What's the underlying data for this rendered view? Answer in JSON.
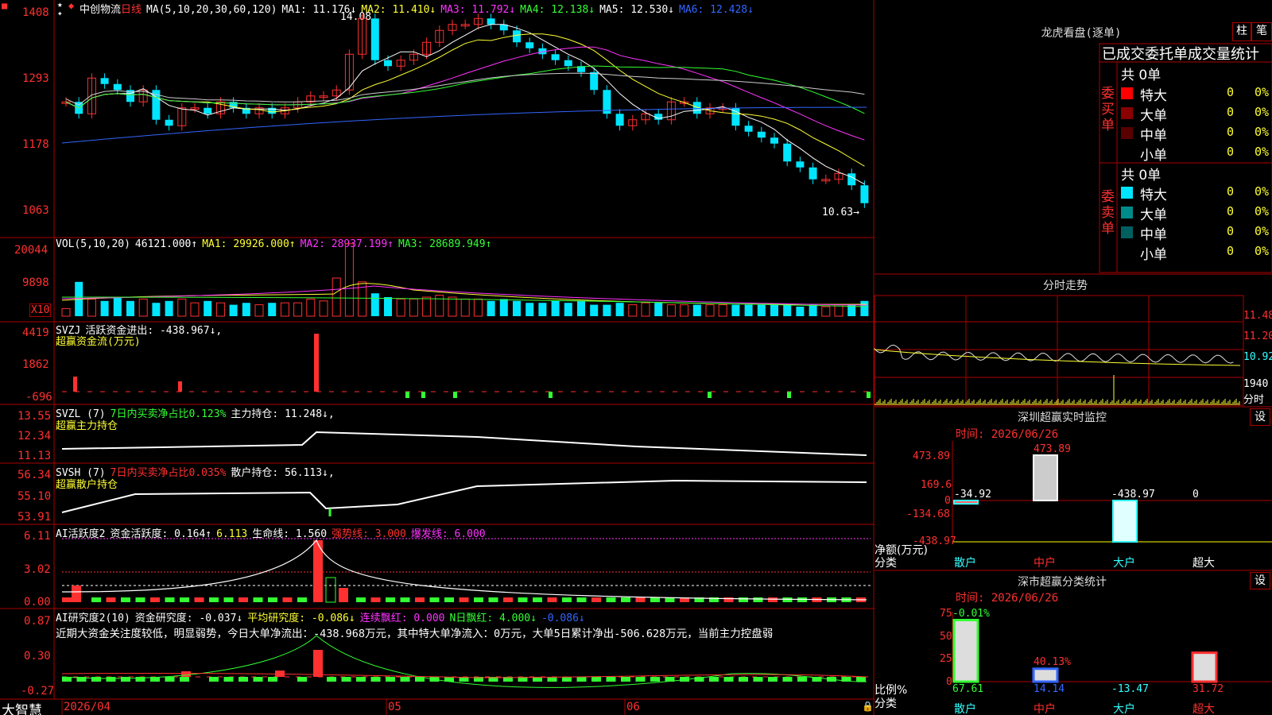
{
  "stock": {
    "name": "中创物流",
    "period": "日线",
    "ma_label": "MA(5,10,20,30,60,120)"
  },
  "price_panel": {
    "ma": [
      {
        "label": "MA1: 11.176↓",
        "color": "#ffffff"
      },
      {
        "label": "MA2: 11.410↓",
        "color": "#ffff33"
      },
      {
        "label": "MA3: 11.792↓",
        "color": "#ff33ff"
      },
      {
        "label": "MA4: 12.138↓",
        "color": "#33ff33"
      },
      {
        "label": "MA5: 12.530↓",
        "color": "#dddddd"
      },
      {
        "label": "MA6: 12.428↓",
        "color": "#3366ff"
      }
    ],
    "y_ticks": [
      "1408",
      "1293",
      "1178",
      "1063"
    ],
    "high_note": "14.08",
    "low_note": "10.63→"
  },
  "vol_panel": {
    "title": "VOL(5,10,20)",
    "value": "46121.000↑",
    "ma": [
      {
        "label": "MA1: 29926.000↑",
        "color": "#ffff33"
      },
      {
        "label": "MA2: 28937.199↑",
        "color": "#ff33ff"
      },
      {
        "label": "MA3: 28689.949↑",
        "color": "#33ff33"
      }
    ],
    "y_ticks": [
      "20044",
      "9898"
    ],
    "unit": "X10"
  },
  "svzj_panel": {
    "title": "SVZJ",
    "line1": "活跃资金进出: -438.967↓,",
    "line2": "超赢资金流(万元)",
    "y_ticks": [
      "4419",
      "1862",
      "-696"
    ]
  },
  "svzl_panel": {
    "title": "SVZL (7)",
    "ratio": "7日内买卖净占比0.123%",
    "hold": "主力持仓: 11.248↓,",
    "sub": "超赢主力持仓",
    "y_ticks": [
      "13.55",
      "12.34",
      "11.13"
    ]
  },
  "svsh_panel": {
    "title": "SVSH (7)",
    "ratio": "7日内买卖净占比0.035%",
    "hold": "散户持仓: 56.113↓,",
    "sub": "超赢散户持仓",
    "y_ticks": [
      "56.34",
      "55.10",
      "53.91"
    ]
  },
  "ai1_panel": {
    "title": "AI活跃度2",
    "a": "资金活跃度: 0.164↑",
    "b": "6.113",
    "c": "生命线: 1.560",
    "d": "强势线: 3.000",
    "e": "爆发线: 6.000",
    "y_ticks": [
      "6.11",
      "3.02",
      "0.00"
    ]
  },
  "ai2_panel": {
    "title": "AI研究度2(10)",
    "a": "资金研究度: -0.037↓",
    "b": "平均研究度: -0.086↓",
    "c": "连续飘红: 0.000",
    "d": "N日飘红: 4.000↓",
    "e": "-0.086↓",
    "comment": "近期大资金关注度较低，明显弱势，今日大单净流出：-438.968万元，其中特大单净流入：0万元，大单5日累计净出-506.628万元，当前主力控盘弱",
    "y_ticks": [
      "0.87",
      "0.30",
      "-0.27"
    ]
  },
  "x_axis": {
    "labels": [
      "2026/04",
      "05",
      "06"
    ],
    "app_name": "大智慧"
  },
  "lhb": {
    "title": "龙虎看盘(逐单)",
    "btn1": "柱",
    "btn2": "笔",
    "subtitle": "已成交委托单成交量统计",
    "buy": {
      "side": "委买单",
      "total": "共 0单",
      "rows": [
        {
          "label": "特大",
          "color": "#ff0000",
          "v": "0",
          "p": "0%"
        },
        {
          "label": "大单",
          "color": "#8b0000",
          "v": "0",
          "p": "0%"
        },
        {
          "label": "中单",
          "color": "#5a0000",
          "v": "0",
          "p": "0%"
        },
        {
          "label": "小单",
          "color": "#000000",
          "v": "0",
          "p": "0%"
        }
      ]
    },
    "sell": {
      "side": "委卖单",
      "total": "共 0单",
      "rows": [
        {
          "label": "特大",
          "color": "#00e5ff",
          "v": "0",
          "p": "0%"
        },
        {
          "label": "大单",
          "color": "#008b8b",
          "v": "0",
          "p": "0%"
        },
        {
          "label": "中单",
          "color": "#006060",
          "v": "0",
          "p": "0%"
        },
        {
          "label": "小单",
          "color": "#000000",
          "v": "0",
          "p": "0%"
        }
      ]
    }
  },
  "intraday": {
    "title": "分时走势",
    "y_ticks": [
      "11.48",
      "11.20",
      "10.92"
    ],
    "vol_tick": "1940",
    "vol_unit": "分时"
  },
  "sz_monitor": {
    "title": "深圳超赢实时监控",
    "btn": "设",
    "time": "时间: 2026/06/26",
    "y_ticks": [
      "473.89",
      "169.6",
      "0",
      "-134.68",
      "-438.97"
    ],
    "bar_labels": [
      "-34.92",
      "473.89",
      "-438.97",
      "0"
    ],
    "cats": [
      "散户",
      "中户",
      "大户",
      "超大"
    ],
    "ylabel": "净额(万元)",
    "xlabel": "分类",
    "chart_data": {
      "type": "bar",
      "categories": [
        "散户",
        "中户",
        "大户",
        "超大"
      ],
      "values": [
        -34.92,
        473.89,
        -438.97,
        0
      ],
      "ylim": [
        -438.97,
        473.89
      ],
      "ylabel": "净额(万元)",
      "xlabel": "分类"
    }
  },
  "sz_class": {
    "title": "深市超赢分类统计",
    "btn": "设",
    "time": "时间: 2026/06/26",
    "y_ticks": [
      "75",
      "50",
      "25",
      "0"
    ],
    "top_labels": [
      "-0.01%",
      "40.13%"
    ],
    "bottom_vals": [
      "67.61",
      "14.14",
      "-13.47",
      "31.72"
    ],
    "cats": [
      "散户",
      "中户",
      "大户",
      "超大"
    ],
    "ylabel": "比例%",
    "xlabel": "分类",
    "chart_data": {
      "type": "bar",
      "categories": [
        "散户",
        "中户",
        "大户",
        "超大"
      ],
      "values": [
        67.61,
        14.14,
        -13.47,
        31.72
      ],
      "ylim": [
        0,
        75
      ],
      "ylabel": "比例%",
      "xlabel": "分类"
    }
  }
}
